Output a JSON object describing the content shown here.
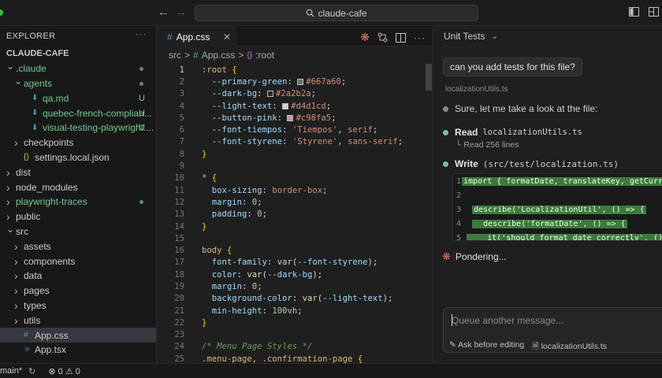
{
  "titlebar": {
    "search_text": "claude-cafe"
  },
  "explorer": {
    "title": "EXPLORER",
    "more": "···",
    "root": "CLAUDE-CAFE",
    "items": [
      {
        "label": ".claude",
        "badge": "",
        "depth": 0,
        "type": "folder-open",
        "color": "green",
        "dot": true
      },
      {
        "label": "agents",
        "badge": "",
        "depth": 1,
        "type": "folder-open",
        "color": "green",
        "dot": true
      },
      {
        "label": "qa.md",
        "badge": "U",
        "depth": 2,
        "type": "md",
        "color": "green"
      },
      {
        "label": "quebec-french-complian...",
        "badge": "U",
        "depth": 2,
        "type": "md",
        "color": "green"
      },
      {
        "label": "visual-testing-playwright....",
        "badge": "U",
        "depth": 2,
        "type": "md",
        "color": "green"
      },
      {
        "label": "checkpoints",
        "badge": "",
        "depth": 1,
        "type": "folder",
        "color": ""
      },
      {
        "label": "settings.local.json",
        "badge": "",
        "depth": 1,
        "type": "json",
        "color": ""
      },
      {
        "label": "dist",
        "badge": "",
        "depth": 0,
        "type": "folder",
        "color": ""
      },
      {
        "label": "node_modules",
        "badge": "",
        "depth": 0,
        "type": "folder",
        "color": ""
      },
      {
        "label": "playwright-traces",
        "badge": "",
        "depth": 0,
        "type": "folder",
        "color": "green",
        "dot": true
      },
      {
        "label": "public",
        "badge": "",
        "depth": 0,
        "type": "folder",
        "color": ""
      },
      {
        "label": "src",
        "badge": "",
        "depth": 0,
        "type": "folder-open",
        "color": ""
      },
      {
        "label": "assets",
        "badge": "",
        "depth": 1,
        "type": "folder",
        "color": ""
      },
      {
        "label": "components",
        "badge": "",
        "depth": 1,
        "type": "folder",
        "color": ""
      },
      {
        "label": "data",
        "badge": "",
        "depth": 1,
        "type": "folder",
        "color": ""
      },
      {
        "label": "pages",
        "badge": "",
        "depth": 1,
        "type": "folder",
        "color": ""
      },
      {
        "label": "types",
        "badge": "",
        "depth": 1,
        "type": "folder",
        "color": ""
      },
      {
        "label": "utils",
        "badge": "",
        "depth": 1,
        "type": "folder",
        "color": ""
      },
      {
        "label": "App.css",
        "badge": "",
        "depth": 1,
        "type": "css",
        "color": "",
        "selected": true
      },
      {
        "label": "App.tsx",
        "badge": "",
        "depth": 1,
        "type": "tsx",
        "color": ""
      }
    ]
  },
  "editor": {
    "tab_label": "App.css",
    "breadcrumb": [
      "src",
      ">",
      "App.css",
      ">",
      ":root"
    ],
    "current_line": 1,
    "lines": [
      {
        "n": "1",
        "t": [
          [
            ":root ",
            "k"
          ],
          [
            "{",
            "y"
          ]
        ]
      },
      {
        "n": "2",
        "t": [
          [
            "  --primary-green",
            "p"
          ],
          [
            ": ",
            "b"
          ],
          [
            "SW#667a60",
            "sw"
          ],
          [
            "#667a60",
            "v"
          ],
          [
            ";",
            "b"
          ]
        ]
      },
      {
        "n": "3",
        "t": [
          [
            "  --dark-bg",
            "p"
          ],
          [
            ": ",
            "b"
          ],
          [
            "SW#2a2b2a",
            "sw"
          ],
          [
            "#2a2b2a",
            "v"
          ],
          [
            ";",
            "b"
          ]
        ]
      },
      {
        "n": "4",
        "t": [
          [
            "  --light-text",
            "p"
          ],
          [
            ": ",
            "b"
          ],
          [
            "SW#d4d1cd",
            "sw"
          ],
          [
            "#d4d1cd",
            "v"
          ],
          [
            ";",
            "b"
          ]
        ]
      },
      {
        "n": "5",
        "t": [
          [
            "  --button-pink",
            "p"
          ],
          [
            ": ",
            "b"
          ],
          [
            "SW#c98fa5",
            "sw"
          ],
          [
            "#c98fa5",
            "v"
          ],
          [
            ";",
            "b"
          ]
        ]
      },
      {
        "n": "6",
        "t": [
          [
            "  --font-tiempos",
            "p"
          ],
          [
            ": ",
            "b"
          ],
          [
            "'Tiempos'",
            "v"
          ],
          [
            ", ",
            "b"
          ],
          [
            "serif",
            "v"
          ],
          [
            ";",
            "b"
          ]
        ]
      },
      {
        "n": "7",
        "t": [
          [
            "  --font-styrene",
            "p"
          ],
          [
            ": ",
            "b"
          ],
          [
            "'Styrene'",
            "v"
          ],
          [
            ", ",
            "b"
          ],
          [
            "sans-serif",
            "v"
          ],
          [
            ";",
            "b"
          ]
        ]
      },
      {
        "n": "8",
        "t": [
          [
            "}",
            "y"
          ]
        ]
      },
      {
        "n": "9",
        "t": []
      },
      {
        "n": "10",
        "t": [
          [
            "* ",
            "k"
          ],
          [
            "{",
            "y"
          ]
        ]
      },
      {
        "n": "11",
        "t": [
          [
            "  box-sizing",
            "p"
          ],
          [
            ": ",
            "b"
          ],
          [
            "border-box",
            "v"
          ],
          [
            ";",
            "b"
          ]
        ]
      },
      {
        "n": "12",
        "t": [
          [
            "  margin",
            "p"
          ],
          [
            ": ",
            "b"
          ],
          [
            "0",
            "n"
          ],
          [
            ";",
            "b"
          ]
        ]
      },
      {
        "n": "13",
        "t": [
          [
            "  padding",
            "p"
          ],
          [
            ": ",
            "b"
          ],
          [
            "0",
            "n"
          ],
          [
            ";",
            "b"
          ]
        ]
      },
      {
        "n": "14",
        "t": [
          [
            "}",
            "y"
          ]
        ]
      },
      {
        "n": "15",
        "t": []
      },
      {
        "n": "16",
        "t": [
          [
            "body ",
            "k"
          ],
          [
            "{",
            "y"
          ]
        ]
      },
      {
        "n": "17",
        "t": [
          [
            "  font-family",
            "p"
          ],
          [
            ": ",
            "b"
          ],
          [
            "var",
            "f"
          ],
          [
            "(",
            "b"
          ],
          [
            "--font-styrene",
            "p"
          ],
          [
            ");",
            "b"
          ]
        ]
      },
      {
        "n": "18",
        "t": [
          [
            "  color",
            "p"
          ],
          [
            ": ",
            "b"
          ],
          [
            "var",
            "f"
          ],
          [
            "(",
            "b"
          ],
          [
            "--dark-bg",
            "p"
          ],
          [
            ");",
            "b"
          ]
        ]
      },
      {
        "n": "19",
        "t": [
          [
            "  margin",
            "p"
          ],
          [
            ": ",
            "b"
          ],
          [
            "0",
            "n"
          ],
          [
            ";",
            "b"
          ]
        ]
      },
      {
        "n": "20",
        "t": [
          [
            "  background-color",
            "p"
          ],
          [
            ": ",
            "b"
          ],
          [
            "var",
            "f"
          ],
          [
            "(",
            "b"
          ],
          [
            "--light-text",
            "p"
          ],
          [
            ");",
            "b"
          ]
        ]
      },
      {
        "n": "21",
        "t": [
          [
            "  min-height",
            "p"
          ],
          [
            ": ",
            "b"
          ],
          [
            "100vh",
            "n"
          ],
          [
            ";",
            "b"
          ]
        ]
      },
      {
        "n": "22",
        "t": [
          [
            "}",
            "y"
          ]
        ]
      },
      {
        "n": "23",
        "t": []
      },
      {
        "n": "24",
        "t": [
          [
            "/* Menu Page Styles */",
            "c"
          ]
        ]
      },
      {
        "n": "25",
        "t": [
          [
            ".menu-page, .confirmation-page ",
            "k"
          ],
          [
            "{",
            "y"
          ]
        ]
      }
    ]
  },
  "chat": {
    "title": "Unit Tests",
    "user_message": "can you add tests for this file?",
    "context_file": "localizationUtils.ts",
    "assistant_text": "Sure, let me take a look at the file:",
    "read_label": "Read",
    "read_target": "localizationUtils.ts",
    "read_result": "Read 256 lines",
    "write_label": "Write",
    "write_target": "(src/test/localization.ts)",
    "diff": [
      {
        "n": "1",
        "t": "import { formatDate, translateKey, getCurr"
      },
      {
        "n": "2",
        "t": ""
      },
      {
        "n": "3",
        "t": "describe('LocalizationUtil', () => {"
      },
      {
        "n": "4",
        "t": "  describe('formatDate', () => {"
      },
      {
        "n": "5",
        "t": "    it('should format date correctly', ()"
      }
    ],
    "status": "Pondering...",
    "input_placeholder": "Queue another message...",
    "ask_label": "Ask before editing",
    "file_chip": "localizationUtils.ts"
  },
  "statusbar": {
    "branch": "main*",
    "errors": "0",
    "warnings": "0"
  },
  "colors": {
    "accent_green": "#73c991",
    "claude_orange": "#d97757",
    "diff_green": "#3c7a3c"
  }
}
